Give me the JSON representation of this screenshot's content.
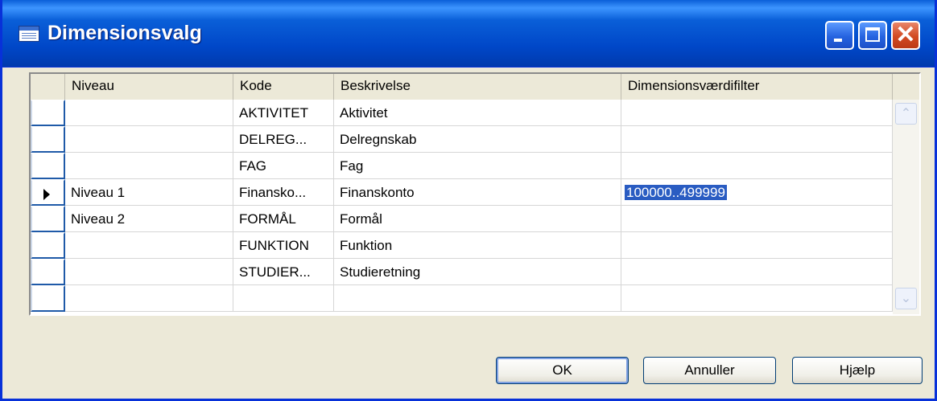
{
  "window": {
    "title": "Dimensionsvalg",
    "icon": "table-icon",
    "controls": {
      "minimize": "minimize-icon",
      "maximize": "maximize-icon",
      "close": "✕"
    }
  },
  "table": {
    "columns": {
      "niveau": "Niveau",
      "kode": "Kode",
      "beskrivelse": "Beskrivelse",
      "filter": "Dimensionsværdifilter"
    },
    "rows": [
      {
        "niveau": "",
        "kode": "AKTIVITET",
        "beskrivelse": "Aktivitet",
        "filter": ""
      },
      {
        "niveau": "",
        "kode": "DELREG...",
        "beskrivelse": "Delregnskab",
        "filter": ""
      },
      {
        "niveau": "",
        "kode": "FAG",
        "beskrivelse": "Fag",
        "filter": ""
      },
      {
        "niveau": "Niveau 1",
        "kode": "Finansko...",
        "beskrivelse": "Finanskonto",
        "filter": "100000..499999"
      },
      {
        "niveau": "Niveau 2",
        "kode": "FORMÅL",
        "beskrivelse": "Formål",
        "filter": ""
      },
      {
        "niveau": "",
        "kode": "FUNKTION",
        "beskrivelse": "Funktion",
        "filter": ""
      },
      {
        "niveau": "",
        "kode": "STUDIER...",
        "beskrivelse": "Studieretning",
        "filter": ""
      },
      {
        "niveau": "",
        "kode": "",
        "beskrivelse": "",
        "filter": ""
      }
    ],
    "current_row_indicator": "row-pointer-icon",
    "assist_button": "⬆"
  },
  "buttons": {
    "ok": "OK",
    "cancel": "Annuller",
    "help": "Hjælp"
  },
  "colors": {
    "titlebar": "#0a5fd8",
    "selection": "#2a5cc2",
    "dialog_bg": "#ece9d8"
  }
}
